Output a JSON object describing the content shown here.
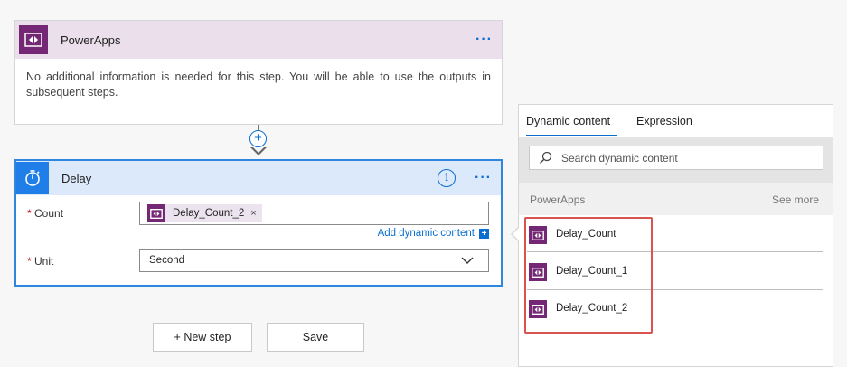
{
  "powerapps_card": {
    "title": "PowerApps",
    "menu_label": "···",
    "description": "No additional information is needed for this step. You will be able to use the outputs in subsequent steps."
  },
  "connector": {
    "add_label": "+"
  },
  "delay_card": {
    "title": "Delay",
    "menu_label": "···",
    "info_label": "i",
    "count_label": "Count",
    "required_marker": "*",
    "count_token": "Delay_Count_2",
    "token_remove": "×",
    "add_dynamic_label": "Add dynamic content",
    "add_dynamic_plus": "+",
    "unit_label": "Unit",
    "unit_value": "Second"
  },
  "buttons": {
    "new_step": "+ New step",
    "save": "Save"
  },
  "dynamic_panel": {
    "tabs": [
      "Dynamic content",
      "Expression"
    ],
    "search_placeholder": "Search dynamic content",
    "group_name": "PowerApps",
    "see_more": "See more",
    "items": [
      "Delay_Count",
      "Delay_Count_1",
      "Delay_Count_2"
    ]
  },
  "colors": {
    "powerapps_brand": "#742774",
    "accent": "#0a6ed1",
    "highlight": "#d9534f"
  }
}
